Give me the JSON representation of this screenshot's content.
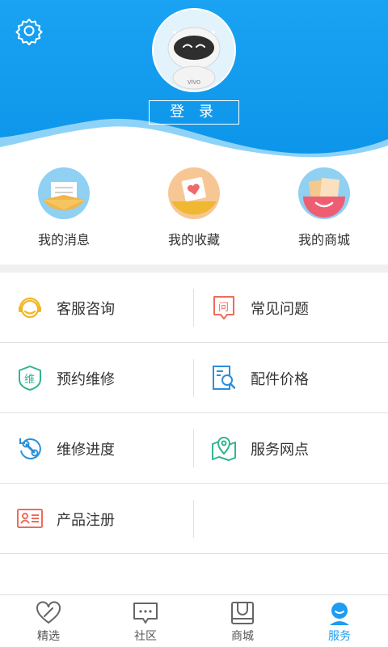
{
  "header": {
    "login_label": "登 录",
    "avatar_brand": "vivo",
    "accent": "#1a9ff0"
  },
  "quick_links": [
    {
      "label": "我的消息",
      "icon": "envelope-icon"
    },
    {
      "label": "我的收藏",
      "icon": "heart-card-icon"
    },
    {
      "label": "我的商城",
      "icon": "shopping-bag-icon"
    }
  ],
  "services": [
    {
      "label": "客服咨询",
      "icon": "headset-icon"
    },
    {
      "label": "常见问题",
      "icon": "question-bubble-icon",
      "icon_text": "问"
    },
    {
      "label": "预约维修",
      "icon": "repair-shield-icon",
      "icon_text": "维"
    },
    {
      "label": "配件价格",
      "icon": "parts-search-icon"
    },
    {
      "label": "维修进度",
      "icon": "progress-wrench-icon"
    },
    {
      "label": "服务网点",
      "icon": "map-pin-icon"
    },
    {
      "label": "产品注册",
      "icon": "id-card-icon"
    }
  ],
  "tabs": [
    {
      "label": "精选",
      "icon": "featured-icon",
      "active": false
    },
    {
      "label": "社区",
      "icon": "chat-bubble-icon",
      "active": false
    },
    {
      "label": "商城",
      "icon": "shop-bag-icon",
      "active": false
    },
    {
      "label": "服务",
      "icon": "service-person-icon",
      "active": true
    }
  ]
}
